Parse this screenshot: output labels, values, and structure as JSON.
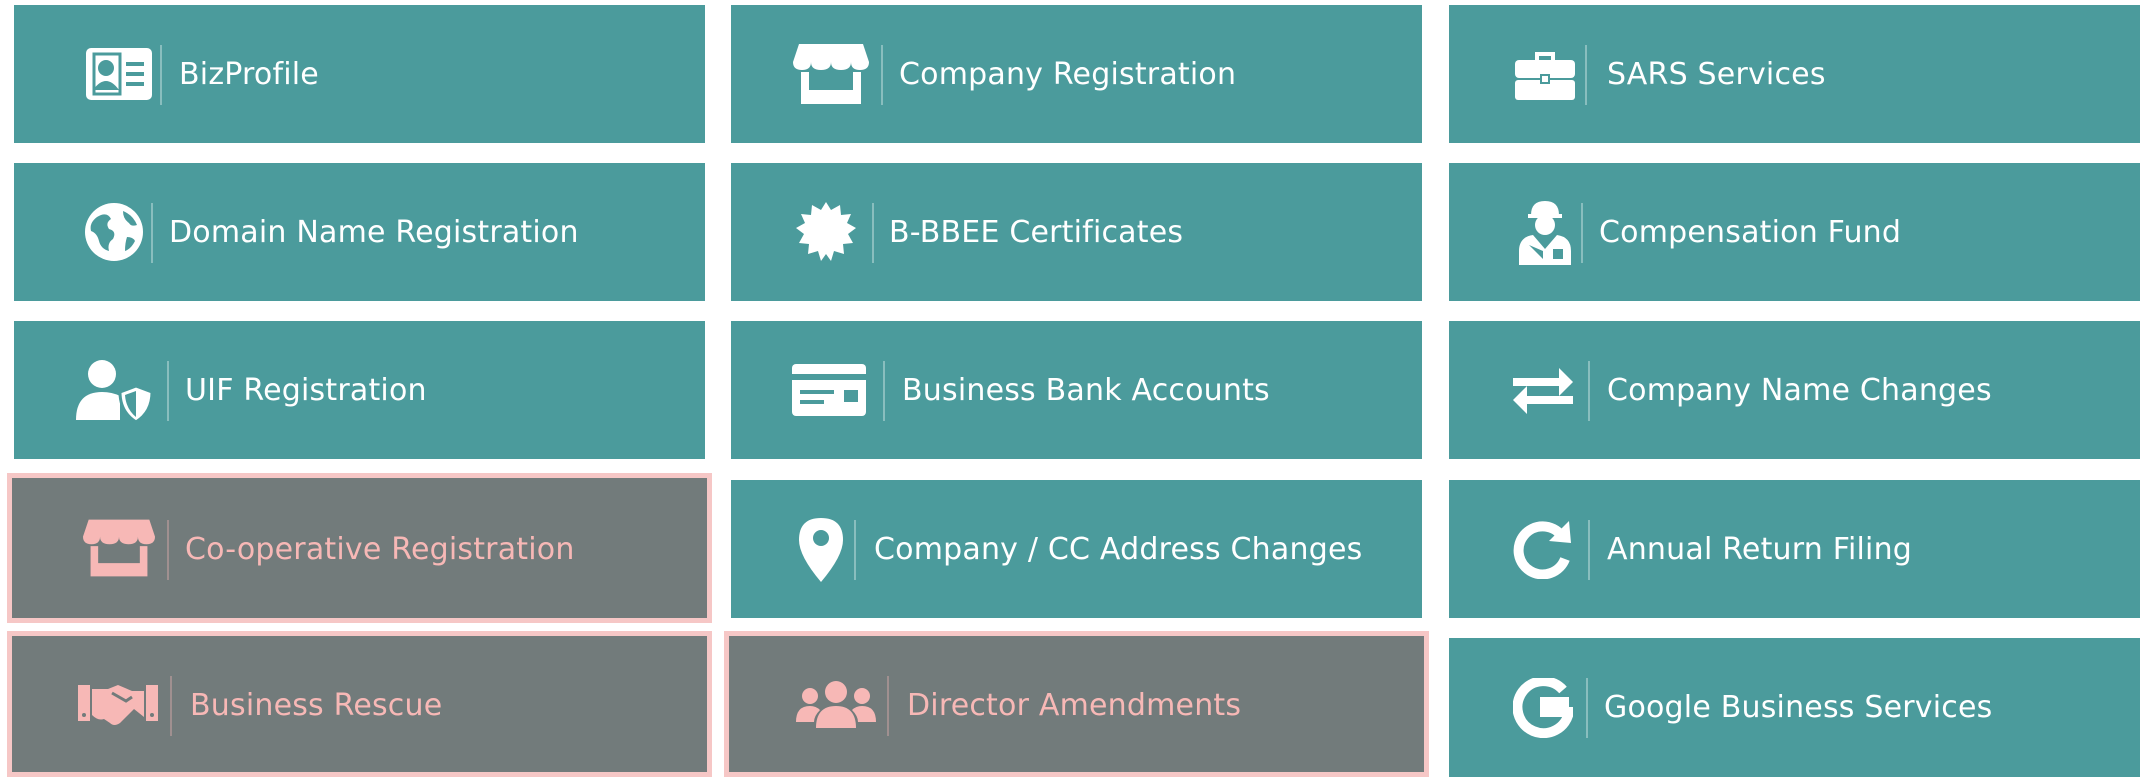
{
  "colors": {
    "tile_bg": "#4b9b9c",
    "tile_active_bg": "#727b7b",
    "tile_active_border": "#f6c7c6",
    "tile_text": "#ffffff",
    "tile_active_text": "#f7b8b6"
  },
  "services": {
    "bizprofile": {
      "label": "BizProfile",
      "icon": "id-card-icon"
    },
    "company_registration": {
      "label": "Company Registration",
      "icon": "storefront-icon"
    },
    "sars_services": {
      "label": "SARS Services",
      "icon": "briefcase-icon"
    },
    "domain_name_registration": {
      "label": "Domain Name Registration",
      "icon": "globe-icon"
    },
    "bbbee_certificates": {
      "label": "B-BBEE Certificates",
      "icon": "certificate-badge-icon"
    },
    "compensation_fund": {
      "label": "Compensation Fund",
      "icon": "injured-worker-icon"
    },
    "uif_registration": {
      "label": "UIF Registration",
      "icon": "user-shield-icon"
    },
    "business_bank_accounts": {
      "label": "Business Bank Accounts",
      "icon": "bank-card-icon"
    },
    "company_name_changes": {
      "label": "Company Name Changes",
      "icon": "exchange-arrows-icon"
    },
    "cooperative_registration": {
      "label": "Co-operative Registration",
      "icon": "storefront-icon",
      "active": true
    },
    "address_changes": {
      "label": "Company / CC Address Changes",
      "icon": "map-pin-icon"
    },
    "annual_return_filing": {
      "label": "Annual Return Filing",
      "icon": "refresh-icon"
    },
    "business_rescue": {
      "label": "Business Rescue",
      "icon": "handshake-icon",
      "active": true
    },
    "director_amendments": {
      "label": "Director Amendments",
      "icon": "users-group-icon",
      "active": true
    },
    "google_business_services": {
      "label": "Google Business Services",
      "icon": "google-g-icon"
    }
  }
}
